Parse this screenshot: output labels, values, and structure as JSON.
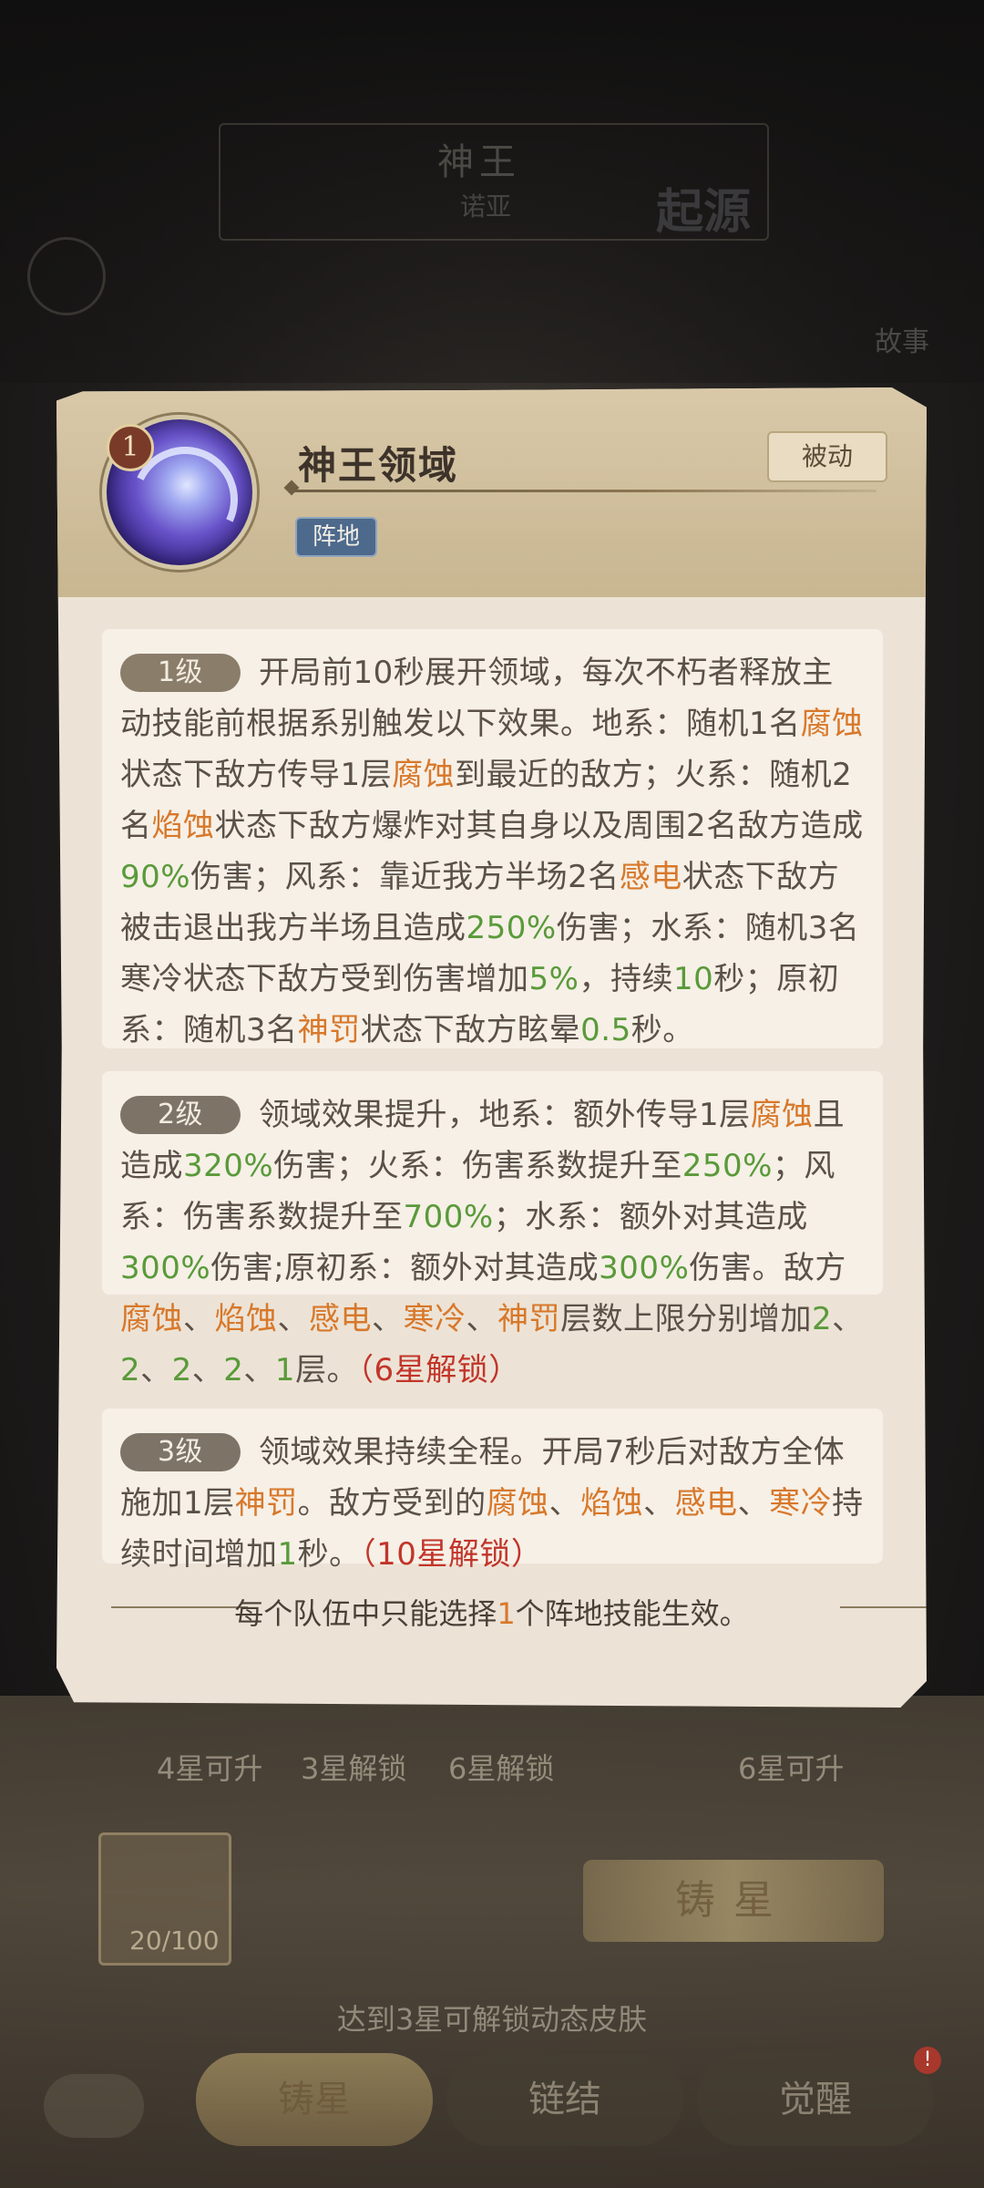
{
  "background": {
    "hero_title": "神王",
    "hero_subtitle": "诺亚",
    "origin_label": "起源",
    "story_label": "故事",
    "star_labels": [
      "4星可升",
      "3星解锁",
      "6星解锁",
      "6星可升"
    ],
    "card_count": "20/100",
    "forge_button": "铸星",
    "unlock_hint": "达到3星可解锁动态皮肤",
    "tabs": [
      "铸星",
      "链结",
      "觉醒"
    ],
    "alert_badge": "!"
  },
  "dialog": {
    "level_badge": "1",
    "skill_name": "神王领域",
    "skill_type": "被动",
    "tag": "阵地",
    "levels": [
      {
        "label": "1级",
        "segments": [
          {
            "t": "开局前10秒展开领域，每次不朽者释放主动技能前根据系别触发以下效果。地系：随机1名",
            "c": ""
          },
          {
            "t": "腐蚀",
            "c": "o"
          },
          {
            "t": "状态下敌方传导1层",
            "c": ""
          },
          {
            "t": "腐蚀",
            "c": "o"
          },
          {
            "t": "到最近的敌方；火系：随机2名",
            "c": ""
          },
          {
            "t": "焰蚀",
            "c": "o"
          },
          {
            "t": "状态下敌方爆炸对其自身以及周围2名敌方造成",
            "c": ""
          },
          {
            "t": "90%",
            "c": "g"
          },
          {
            "t": "伤害；风系：靠近我方半场2名",
            "c": ""
          },
          {
            "t": "感电",
            "c": "o"
          },
          {
            "t": "状态下敌方被击退出我方半场且造成",
            "c": ""
          },
          {
            "t": "250%",
            "c": "g"
          },
          {
            "t": "伤害；水系：随机3名寒冷状态下敌方受到伤害增加",
            "c": ""
          },
          {
            "t": "5%",
            "c": "g"
          },
          {
            "t": "，持续",
            "c": ""
          },
          {
            "t": "10",
            "c": "g"
          },
          {
            "t": "秒；原初系：随机3名",
            "c": ""
          },
          {
            "t": "神罚",
            "c": "o"
          },
          {
            "t": "状态下敌方眩晕",
            "c": ""
          },
          {
            "t": "0.5",
            "c": "g"
          },
          {
            "t": "秒。",
            "c": ""
          }
        ]
      },
      {
        "label": "2级",
        "segments": [
          {
            "t": "领域效果提升，地系：额外传导1层",
            "c": ""
          },
          {
            "t": "腐蚀",
            "c": "o"
          },
          {
            "t": "且造成",
            "c": ""
          },
          {
            "t": "320%",
            "c": "g"
          },
          {
            "t": "伤害；火系：伤害系数提升至",
            "c": ""
          },
          {
            "t": "250%",
            "c": "g"
          },
          {
            "t": "；风系：伤害系数提升至",
            "c": ""
          },
          {
            "t": "700%",
            "c": "g"
          },
          {
            "t": "；水系：额外对其造成",
            "c": ""
          },
          {
            "t": "300%",
            "c": "g"
          },
          {
            "t": "伤害;原初系：额外对其造成",
            "c": ""
          },
          {
            "t": "300%",
            "c": "g"
          },
          {
            "t": "伤害。敌方",
            "c": ""
          },
          {
            "t": "腐蚀",
            "c": "o"
          },
          {
            "t": "、",
            "c": ""
          },
          {
            "t": "焰蚀",
            "c": "o"
          },
          {
            "t": "、",
            "c": ""
          },
          {
            "t": "感电",
            "c": "o"
          },
          {
            "t": "、",
            "c": ""
          },
          {
            "t": "寒冷",
            "c": "o"
          },
          {
            "t": "、",
            "c": ""
          },
          {
            "t": "神罚",
            "c": "o"
          },
          {
            "t": "层数上限分别增加",
            "c": ""
          },
          {
            "t": "2",
            "c": "g"
          },
          {
            "t": "、",
            "c": ""
          },
          {
            "t": "2",
            "c": "g"
          },
          {
            "t": "、",
            "c": ""
          },
          {
            "t": "2",
            "c": "g"
          },
          {
            "t": "、",
            "c": ""
          },
          {
            "t": "2",
            "c": "g"
          },
          {
            "t": "、",
            "c": ""
          },
          {
            "t": "1",
            "c": "g"
          },
          {
            "t": "层。",
            "c": ""
          },
          {
            "t": "（6星解锁）",
            "c": "r"
          }
        ]
      },
      {
        "label": "3级",
        "segments": [
          {
            "t": "领域效果持续全程。开局7秒后对敌方全体施加1层",
            "c": ""
          },
          {
            "t": "神罚",
            "c": "o"
          },
          {
            "t": "。敌方受到的",
            "c": ""
          },
          {
            "t": "腐蚀",
            "c": "o"
          },
          {
            "t": "、",
            "c": ""
          },
          {
            "t": "焰蚀",
            "c": "o"
          },
          {
            "t": "、",
            "c": ""
          },
          {
            "t": "感电",
            "c": "o"
          },
          {
            "t": "、",
            "c": ""
          },
          {
            "t": "寒冷",
            "c": "o"
          },
          {
            "t": "持续时间增加",
            "c": ""
          },
          {
            "t": "1",
            "c": "g"
          },
          {
            "t": "秒。",
            "c": ""
          },
          {
            "t": "（10星解锁）",
            "c": "r"
          }
        ]
      }
    ],
    "footer_prefix": "每个队伍中只能选择",
    "footer_number": "1",
    "footer_suffix": "个阵地技能生效。"
  },
  "colors": {
    "orange": "#d8782a",
    "green": "#5a9a3a",
    "red": "#c2352a"
  }
}
